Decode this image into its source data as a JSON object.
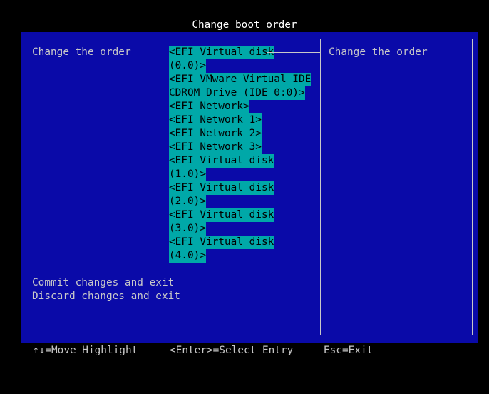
{
  "title": "Change boot order",
  "prompt_label": "Change the order",
  "boot_entries": [
    "<EFI Virtual disk",
    "(0.0)>",
    "<EFI VMware Virtual IDE",
    "CDROM Drive (IDE 0:0)>",
    "<EFI Network>",
    "<EFI Network 1>",
    "<EFI Network 2>",
    "<EFI Network 3>",
    "<EFI Virtual disk",
    "(1.0)>",
    "<EFI Virtual disk",
    "(2.0)>",
    "<EFI Virtual disk",
    "(3.0)>",
    "<EFI Virtual disk",
    "(4.0)>"
  ],
  "help_text": "Change the order",
  "actions": {
    "commit": "Commit changes and exit",
    "discard": "Discard changes and exit"
  },
  "footer": {
    "move": "↑↓=Move Highlight",
    "select": "<Enter>=Select Entry",
    "exit": "Esc=Exit"
  },
  "colors": {
    "screen_background": "#000000",
    "panel_background": "#0a0aa8",
    "highlight_background": "#00a8a8",
    "text_light": "#c8c8c8",
    "title_text": "#ffffff"
  }
}
